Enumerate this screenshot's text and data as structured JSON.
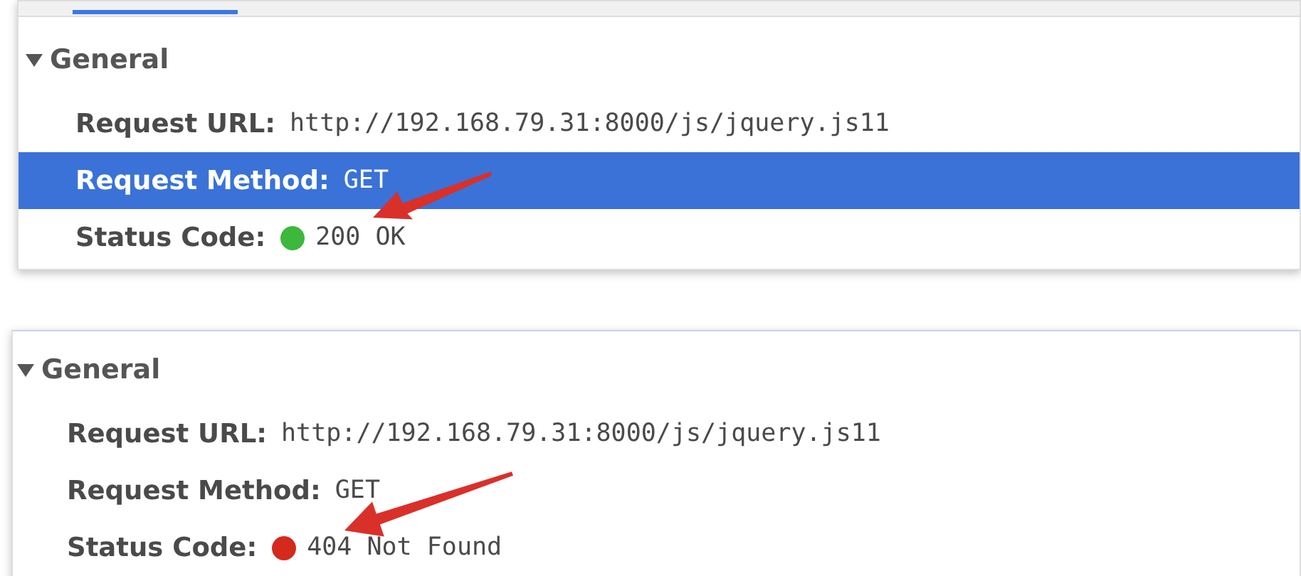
{
  "panels": [
    {
      "tab_strip": true,
      "section": {
        "label": "General",
        "expanded": true
      },
      "rows": [
        {
          "label": "Request URL:",
          "value": "http://192.168.79.31:8000/js/jquery.js11",
          "selected": false
        },
        {
          "label": "Request Method:",
          "value": "GET",
          "selected": true
        },
        {
          "label": "Status Code:",
          "value": "200 OK",
          "selected": false,
          "color": "#3cb83c"
        }
      ]
    },
    {
      "tab_strip": false,
      "section": {
        "label": "General",
        "expanded": true
      },
      "rows": [
        {
          "label": "Request URL:",
          "value": "http://192.168.79.31:8000/js/jquery.js11",
          "selected": false
        },
        {
          "label": "Request Method:",
          "value": "GET",
          "selected": false
        },
        {
          "label": "Status Code:",
          "value": "404 Not Found",
          "selected": false,
          "color": "#d42a1e"
        }
      ]
    }
  ]
}
